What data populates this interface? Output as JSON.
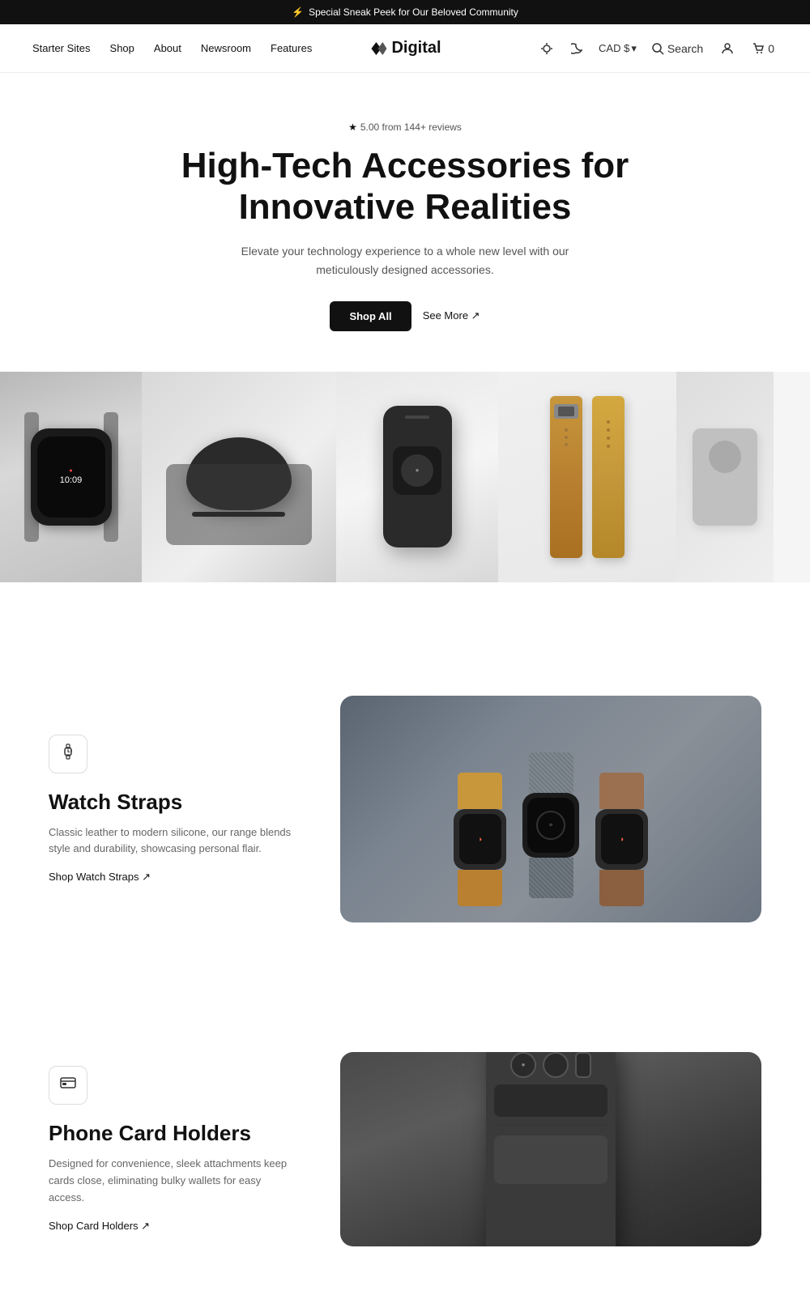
{
  "announcement": {
    "bolt_icon": "⚡",
    "text": "Special Sneak Peek for Our Beloved Community"
  },
  "header": {
    "nav_links": [
      {
        "label": "Starter Sites",
        "id": "starter-sites"
      },
      {
        "label": "Shop",
        "id": "shop"
      },
      {
        "label": "About",
        "id": "about"
      },
      {
        "label": "Newsroom",
        "id": "newsroom"
      },
      {
        "label": "Features",
        "id": "features"
      }
    ],
    "logo_text": "Digital",
    "currency": "CAD $",
    "currency_icon": "▾",
    "search_label": "Search",
    "cart_count": "0"
  },
  "hero": {
    "rating_star": "★",
    "rating_text": "5.00 from 144+ reviews",
    "headline_line1": "High-Tech Accessories for",
    "headline_line2": "Innovative Realities",
    "description": "Elevate your technology experience to a whole new level with our meticulously designed accessories.",
    "cta_primary": "Shop All",
    "cta_secondary": "See More ↗"
  },
  "gallery": {
    "items": [
      {
        "id": "watch",
        "alt": "Smart Watch"
      },
      {
        "id": "mouse",
        "alt": "Computer Mouse"
      },
      {
        "id": "phone-case",
        "alt": "Phone Case"
      },
      {
        "id": "strap",
        "alt": "Watch Strap"
      },
      {
        "id": "stand",
        "alt": "Phone Stand"
      }
    ]
  },
  "sections": [
    {
      "id": "watch-straps",
      "icon": "⌚",
      "title": "Watch Straps",
      "description": "Classic leather to modern silicone, our range blends style and durability, showcasing personal flair.",
      "link_text": "Shop Watch Straps ↗",
      "image_alt": "Watch Straps Collection"
    },
    {
      "id": "phone-card-holders",
      "icon": "🗂",
      "title": "Phone Card Holders",
      "description": "Designed for convenience, sleek attachments keep cards close, eliminating bulky wallets for easy access.",
      "link_text": "Shop Card Holders ↗",
      "image_alt": "Phone Card Holders"
    }
  ]
}
